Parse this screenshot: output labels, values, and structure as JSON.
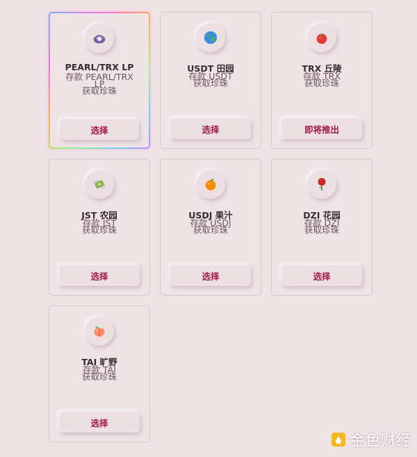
{
  "farms": [
    {
      "title": "PEARL/TRX LP",
      "desc": [
        "存款 PEARL/TRX",
        "LP",
        "获取珍珠"
      ],
      "button": "选择",
      "icon": "pearl-oyster-icon",
      "featured": true
    },
    {
      "title": "USDT 田园",
      "desc": [
        "存款 USDT",
        "获取珍珠"
      ],
      "button": "选择",
      "icon": "globe-icon"
    },
    {
      "title": "TRX 丘陵",
      "desc": [
        "存款 TRX",
        "获取珍珠"
      ],
      "button": "即将推出",
      "icon": "tomato-icon"
    },
    {
      "title": "JST 农园",
      "desc": [
        "存款 JST",
        "获取珍珠"
      ],
      "button": "选择",
      "icon": "money-wings-icon"
    },
    {
      "title": "USDJ 果汁",
      "desc": [
        "存款 USDJ",
        "获取珍珠"
      ],
      "button": "选择",
      "icon": "orange-icon"
    },
    {
      "title": "DZI 花园",
      "desc": [
        "存款 DZI",
        "获取珍珠"
      ],
      "button": "选择",
      "icon": "rose-icon"
    },
    {
      "title": "TAI 旷野",
      "desc": [
        "存款 TAI",
        "获取珍珠"
      ],
      "button": "选择",
      "icon": "peach-icon"
    }
  ],
  "watermark": {
    "text": "金色财经",
    "icon": "jinse-logo-icon"
  },
  "colors": {
    "background": "#efe3e6",
    "accent": "#a51747",
    "title": "#3a2a31",
    "desc": "#6b5660"
  }
}
